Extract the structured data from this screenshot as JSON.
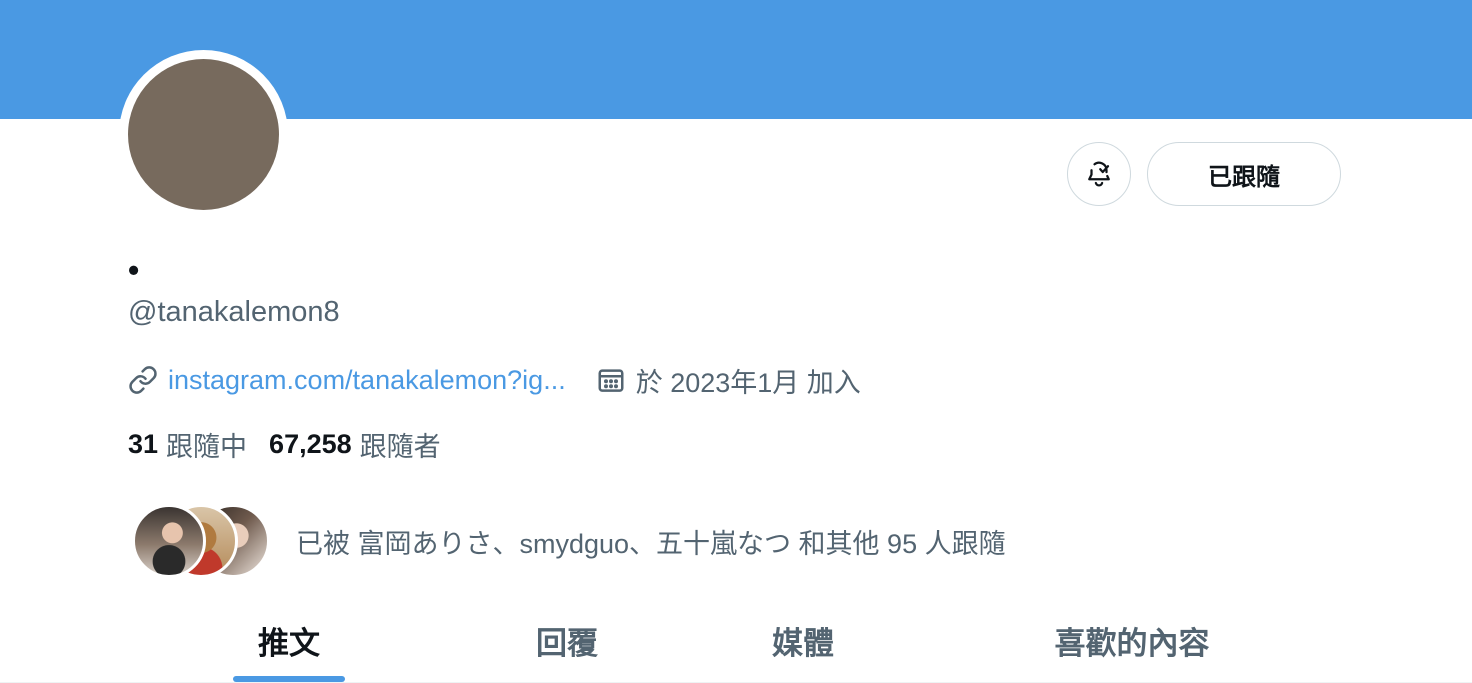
{
  "profile": {
    "display_name": "•",
    "handle": "@tanakalemon8",
    "link": "instagram.com/tanakalemon?ig...",
    "joined": "於 2023年1月 加入",
    "following_count": "31",
    "following_label": "跟隨中",
    "followers_count": "67,258",
    "followers_label": "跟隨者"
  },
  "actions": {
    "notify_icon": "bell-check-icon",
    "follow_label": "已跟隨"
  },
  "followed_by": {
    "text": "已被 富岡ありさ、smydguo、五十嵐なつ 和其他 95 人跟隨"
  },
  "tabs": [
    {
      "label": "推文",
      "active": true
    },
    {
      "label": "回覆",
      "active": false
    },
    {
      "label": "媒體",
      "active": false
    },
    {
      "label": "喜歡的內容",
      "active": false
    }
  ],
  "colors": {
    "accent": "#4a99e3",
    "banner": "#4a99e3",
    "secondary_text": "#536471",
    "primary_text": "#0f1419",
    "avatar": "#776a5d"
  }
}
